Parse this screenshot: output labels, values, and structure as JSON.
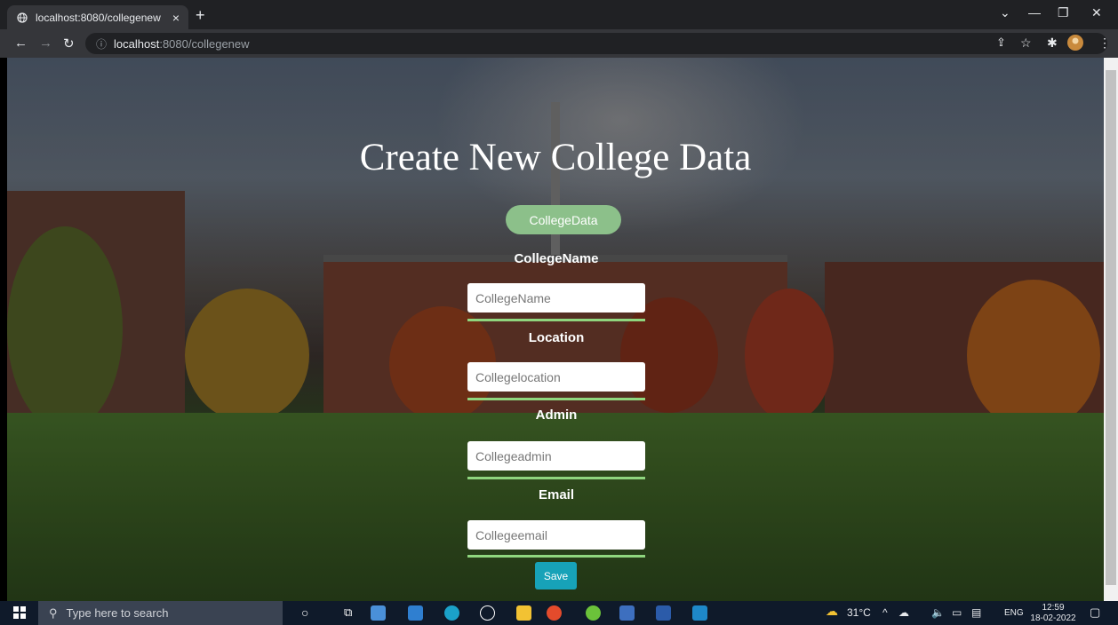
{
  "browser": {
    "tab_title": "localhost:8080/collegenew",
    "tab_close": "×",
    "new_tab": "+",
    "url_host": "localhost",
    "url_path": ":8080/collegenew"
  },
  "page": {
    "title": "Create New College Data",
    "badge": "CollegeData",
    "fields": [
      {
        "label": "CollegeName",
        "placeholder": "CollegeName"
      },
      {
        "label": "Location",
        "placeholder": "Collegelocation"
      },
      {
        "label": "Admin",
        "placeholder": "Collegeadmin"
      },
      {
        "label": "Email",
        "placeholder": "Collegeemail"
      }
    ],
    "save_label": "Save"
  },
  "taskbar": {
    "search_placeholder": "Type here to search",
    "weather": "31°C",
    "lang": "ENG",
    "time": "12:59",
    "date": "18-02-2022"
  },
  "colors": {
    "badge": "#8cc08a",
    "underline": "#8fd67e",
    "save_button": "#17a2b8"
  }
}
